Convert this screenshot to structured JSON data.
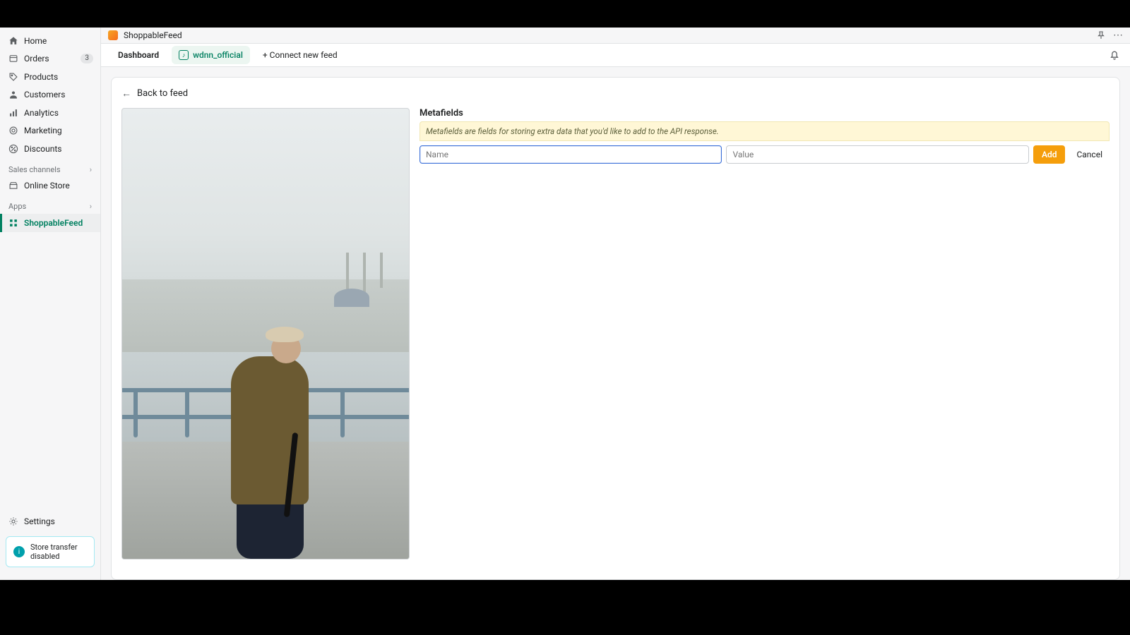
{
  "app": {
    "name": "ShoppableFeed"
  },
  "header_actions": {
    "pin": "pin",
    "more": "more"
  },
  "sidebar": {
    "items": [
      {
        "label": "Home"
      },
      {
        "label": "Orders",
        "badge": "3"
      },
      {
        "label": "Products"
      },
      {
        "label": "Customers"
      },
      {
        "label": "Analytics"
      },
      {
        "label": "Marketing"
      },
      {
        "label": "Discounts"
      }
    ],
    "sections": {
      "sales_channels": "Sales channels",
      "apps": "Apps"
    },
    "sales_channels": [
      {
        "label": "Online Store"
      }
    ],
    "apps": [
      {
        "label": "ShoppableFeed"
      }
    ],
    "settings": "Settings",
    "notice": "Store transfer disabled"
  },
  "tabs": {
    "dashboard": "Dashboard",
    "feed_handle": "wdnn_official",
    "connect": "+ Connect new feed"
  },
  "page": {
    "back": "Back to feed",
    "meta_title": "Metafields",
    "meta_help": "Metafields are fields for storing extra data that you'd like to add to the API response.",
    "name_placeholder": "Name",
    "value_placeholder": "Value",
    "add": "Add",
    "cancel": "Cancel"
  }
}
